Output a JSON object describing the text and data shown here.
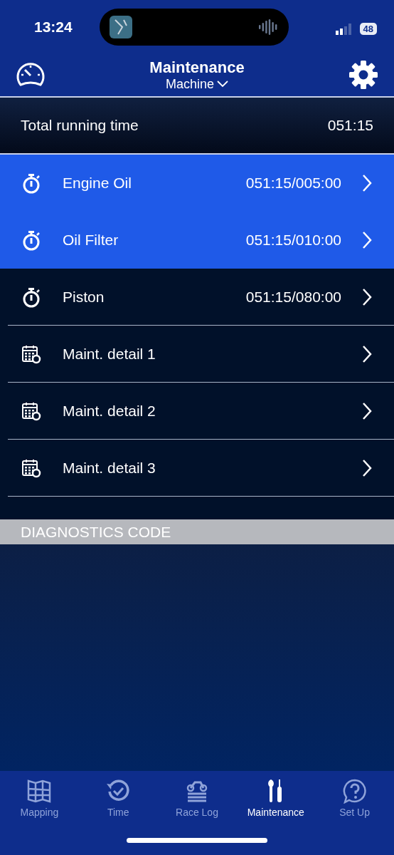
{
  "status_bar": {
    "time": "13:24",
    "battery": "48"
  },
  "header": {
    "title": "Maintenance",
    "subtitle": "Machine"
  },
  "summary": {
    "label": "Total running time",
    "value": "051:15"
  },
  "items": [
    {
      "kind": "timer",
      "label": "Engine Oil",
      "value": "051:15/005:00",
      "highlighted": true
    },
    {
      "kind": "timer",
      "label": "Oil Filter",
      "value": "051:15/010:00",
      "highlighted": true
    },
    {
      "kind": "timer",
      "label": "Piston",
      "value": "051:15/080:00",
      "highlighted": false
    },
    {
      "kind": "calendar",
      "label": "Maint. detail 1",
      "highlighted": false
    },
    {
      "kind": "calendar",
      "label": "Maint. detail 2",
      "highlighted": false
    },
    {
      "kind": "calendar",
      "label": "Maint. detail 3",
      "highlighted": false
    }
  ],
  "section": {
    "title": "DIAGNOSTICS CODE"
  },
  "tabs": [
    {
      "kind": "map",
      "label": "Mapping",
      "selected": false
    },
    {
      "kind": "time",
      "label": "Time",
      "selected": false
    },
    {
      "kind": "log",
      "label": "Race Log",
      "selected": false
    },
    {
      "kind": "tools",
      "label": "Maintenance",
      "selected": true
    },
    {
      "kind": "help",
      "label": "Set Up",
      "selected": false
    }
  ]
}
